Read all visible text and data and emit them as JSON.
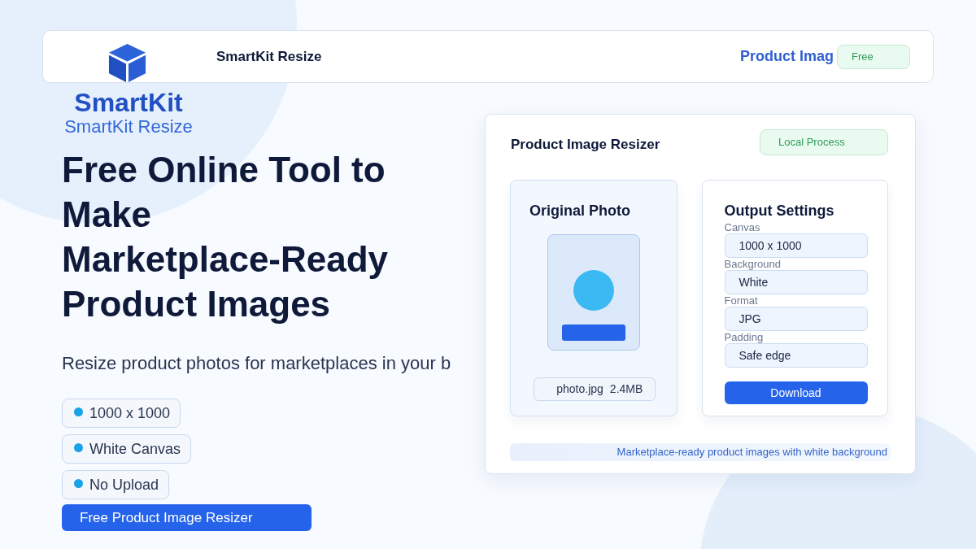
{
  "header": {
    "title": "SmartKit Resize",
    "nav_link": "Product Imag",
    "badge": "Free"
  },
  "logo": {
    "name": "SmartKit",
    "subtitle": "SmartKit Resize"
  },
  "hero": {
    "title_lines": [
      "Free Online Tool to",
      "Make",
      "Marketplace-Ready",
      "Product Images"
    ],
    "subtitle": "Resize product photos for marketplaces in your b",
    "features": [
      "1000 x 1000",
      "White Canvas",
      "No Upload"
    ],
    "cta": "Free Product Image Resizer"
  },
  "tool_card": {
    "title": "Product Image Resizer",
    "badge": "Local Process",
    "original_panel": {
      "title": "Original Photo",
      "file_name": "photo.jpg",
      "file_size": "2.4MB"
    },
    "settings_panel": {
      "title": "Output Settings",
      "fields": [
        {
          "label": "Canvas",
          "value": "1000 x 1000"
        },
        {
          "label": "Background",
          "value": "White"
        },
        {
          "label": "Format",
          "value": "JPG"
        },
        {
          "label": "Padding",
          "value": "Safe edge"
        }
      ],
      "button": "Download"
    },
    "caption": "Marketplace-ready product images with white background"
  }
}
